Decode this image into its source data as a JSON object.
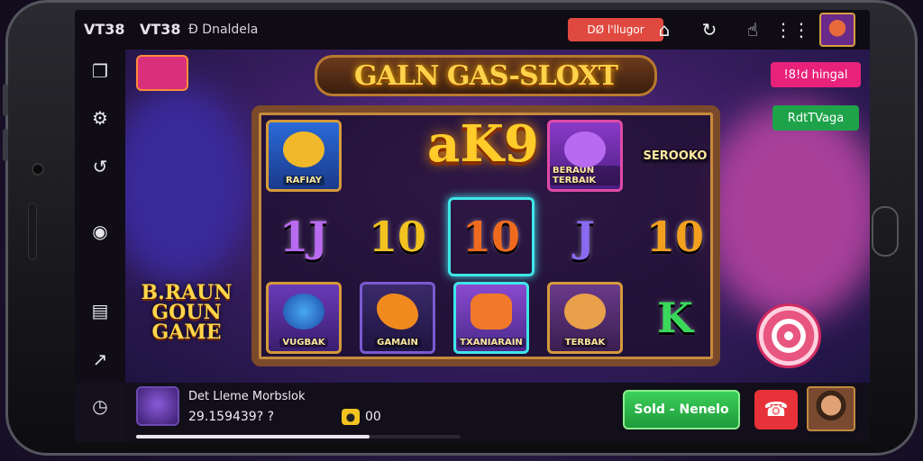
{
  "topbar": {
    "brand": "VT38",
    "title": "VT38",
    "subtitle": "Ɖ Dnaldela",
    "red_button": "DØ l'llugor"
  },
  "game": {
    "title": "GALN GAS-SLOXT",
    "pink_button": "!8!d hingal",
    "green_button": "RdtTVaga",
    "center_logo": "aK9",
    "left_badge": [
      "B.RAUN",
      "GOUN",
      "GAME"
    ],
    "reels": [
      [
        "RAFIAY",
        "1J",
        "VUGBAK"
      ],
      [
        "",
        "10",
        "GAMAIN"
      ],
      [
        "",
        "10",
        "TXANIARAIN"
      ],
      [
        "BERAUN TERBAIK",
        "J",
        "TERBAK"
      ],
      [
        "SEROOKO",
        "10",
        "K"
      ]
    ]
  },
  "bottom": {
    "title": "Det Lleme Morbslok",
    "amount": "29.159439? ?",
    "coin": "●",
    "zero": "00",
    "progress": 0.72,
    "sold_button": "Sold - Nenelo",
    "call_icon": "phone-hangup-icon"
  },
  "icons": {
    "top": [
      "home-icon",
      "share-icon",
      "hand-icon",
      "menu-icon"
    ],
    "rail": [
      "copy-icon",
      "settings-icon",
      "refresh-icon",
      "audio-icon",
      "card-icon",
      "expand-icon",
      "clock-icon"
    ]
  }
}
